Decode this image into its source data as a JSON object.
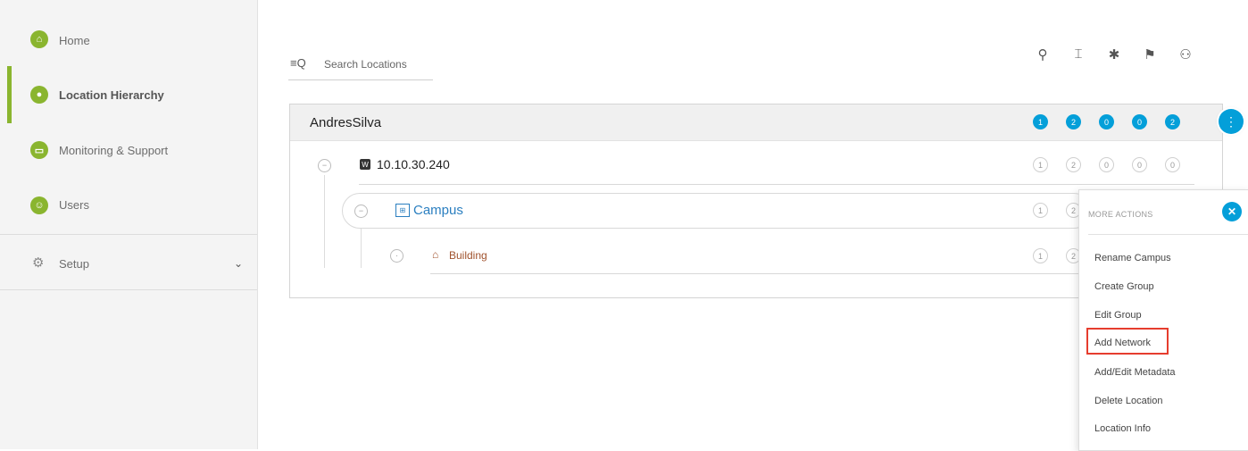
{
  "sidebar": {
    "items": [
      {
        "label": "Home",
        "icon": "home-icon"
      },
      {
        "label": "Location Hierarchy",
        "icon": "location-pin-icon"
      },
      {
        "label": "Monitoring & Support",
        "icon": "monitor-icon"
      },
      {
        "label": "Users",
        "icon": "users-icon"
      }
    ],
    "setup_label": "Setup",
    "setup_icon": "gear-icon",
    "accent_color": "#8ab52f"
  },
  "search": {
    "placeholder": "Search Locations",
    "icon": "search-filter-icon"
  },
  "toolbar_icons": [
    "location-pin-icon",
    "access-point-icon",
    "bluetooth-icon",
    "report-icon",
    "user-icon"
  ],
  "hierarchy": {
    "root": {
      "name": "AndresSilva",
      "counts": [
        "1",
        "2",
        "0",
        "0",
        "2"
      ]
    },
    "wlc": {
      "badge": "W",
      "name": "10.10.30.240",
      "counts": [
        "1",
        "2",
        "0",
        "0",
        "0"
      ]
    },
    "campus": {
      "name": "Campus",
      "counts": [
        "1",
        "2"
      ]
    },
    "building": {
      "name": "Building",
      "counts": [
        "1",
        "2"
      ]
    }
  },
  "more_actions": {
    "title": "MORE ACTIONS",
    "items": [
      "Rename Campus",
      "Create Group",
      "Edit Group",
      "Add Network",
      "Add/Edit Metadata",
      "Delete Location",
      "Location Info"
    ]
  },
  "colors": {
    "badge_blue": "#049fd9",
    "campus_blue": "#2b7fc0",
    "building_brown": "#a0522d",
    "highlight_red": "#e63d2e"
  }
}
